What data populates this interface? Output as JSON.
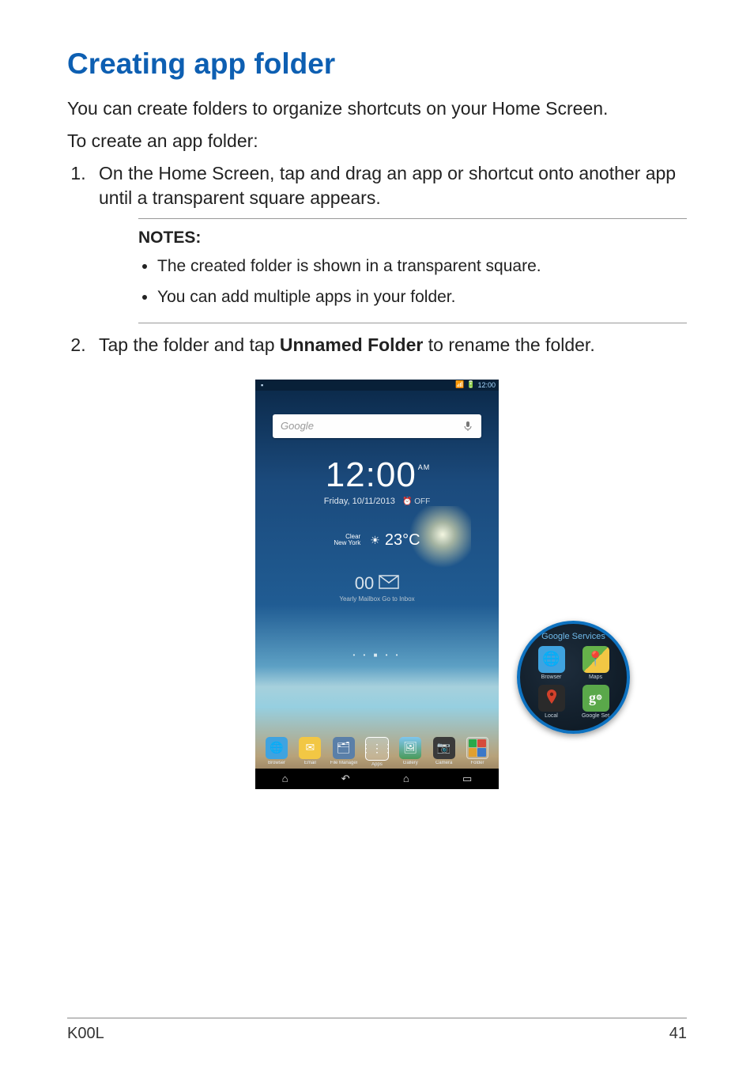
{
  "heading": "Creating app folder",
  "intro1": "You can create folders to organize shortcuts on your Home Screen.",
  "intro2": "To create an app folder:",
  "steps": {
    "s1": "On the Home Screen, tap and drag an app or shortcut onto another app until a transparent square appears.",
    "s2_pre": "Tap the folder and tap ",
    "s2_bold": "Unnamed Folder",
    "s2_post": " to rename the folder."
  },
  "notes": {
    "title": "NOTES:",
    "n1": "The created folder is shown in a transparent square.",
    "n2": "You can add multiple apps in your folder."
  },
  "phone": {
    "status": {
      "wifi": "📶",
      "batt": "🔋",
      "time": "12:00"
    },
    "search_placeholder": "Google",
    "clock": {
      "time": "12:00",
      "ampm": "AM",
      "date": "Friday, 10/11/2013",
      "alarm": "⏰ OFF"
    },
    "weather": {
      "cond": "Clear",
      "city": "New York",
      "icon": "☀",
      "temp": "23°C"
    },
    "mail": {
      "count": "00",
      "sub": "Yearly Mailbox   Go to Inbox"
    },
    "dock": {
      "d1": "Browser",
      "d2": "Email",
      "d3": "File Manager",
      "d4": "Apps",
      "d5": "Gallery",
      "d6": "Camera",
      "d7": "Folder"
    }
  },
  "callout": {
    "title": "Google Services",
    "a1": "Browser",
    "a2": "Maps",
    "a3": "Local",
    "a4": "Google Set"
  },
  "footer": {
    "model": "K00L",
    "page": "41"
  }
}
